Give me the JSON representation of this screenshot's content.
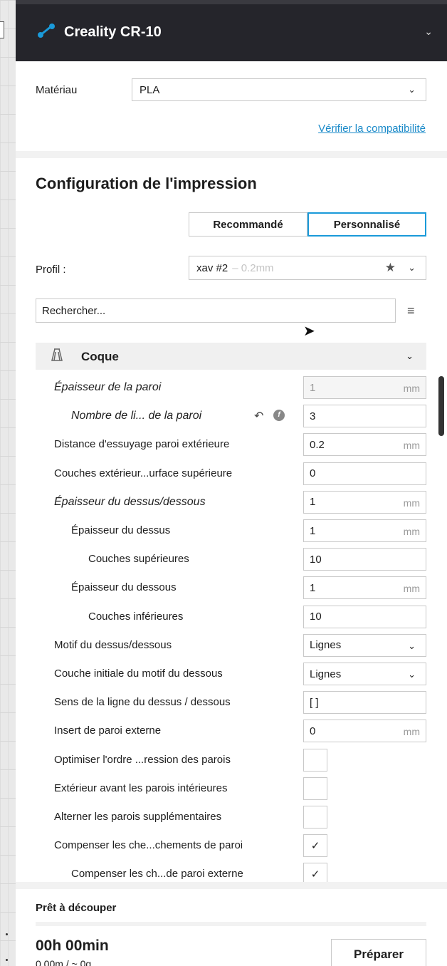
{
  "printer": {
    "name": "Creality CR-10"
  },
  "material": {
    "label": "Matériau",
    "value": "PLA",
    "compat_link": "Vérifier la compatibilité"
  },
  "print_setup": {
    "title": "Configuration de l'impression",
    "modes": [
      "Recommandé",
      "Personnalisé"
    ],
    "active_mode": "Personnalisé",
    "profile_label": "Profil :",
    "profile_name": "xav #2",
    "profile_detail": "– 0.2mm",
    "search_placeholder": "Rechercher...",
    "category": "Coque"
  },
  "settings": [
    {
      "label": "Épaisseur de la paroi",
      "value": "1",
      "unit": "mm",
      "kind": "text",
      "italic": true,
      "indent": 0,
      "disabled": true
    },
    {
      "label": "Nombre de li... de la paroi",
      "value": "3",
      "unit": "",
      "kind": "text",
      "italic": true,
      "indent": 1
    },
    {
      "label": "Distance d'essuyage paroi extérieure",
      "value": "0.2",
      "unit": "mm",
      "kind": "text",
      "indent": 0
    },
    {
      "label": "Couches extérieur...urface supérieure",
      "value": "0",
      "unit": "",
      "kind": "text",
      "indent": 0
    },
    {
      "label": "Épaisseur du dessus/dessous",
      "value": "1",
      "unit": "mm",
      "kind": "text",
      "italic": true,
      "indent": 0
    },
    {
      "label": "Épaisseur du dessus",
      "value": "1",
      "unit": "mm",
      "kind": "text",
      "indent": 1
    },
    {
      "label": "Couches supérieures",
      "value": "10",
      "unit": "",
      "kind": "text",
      "indent": 2
    },
    {
      "label": "Épaisseur du dessous",
      "value": "1",
      "unit": "mm",
      "kind": "text",
      "indent": 1
    },
    {
      "label": "Couches inférieures",
      "value": "10",
      "unit": "",
      "kind": "text",
      "indent": 2
    },
    {
      "label": "Motif du dessus/dessous",
      "value": "Lignes",
      "unit": "",
      "kind": "select",
      "indent": 0
    },
    {
      "label": "Couche initiale du motif du dessous",
      "value": "Lignes",
      "unit": "",
      "kind": "select",
      "indent": 0
    },
    {
      "label": "Sens de la ligne du dessus / dessous",
      "value": "[ ]",
      "unit": "",
      "kind": "text",
      "indent": 0
    },
    {
      "label": "Insert de paroi externe",
      "value": "0",
      "unit": "mm",
      "kind": "text",
      "indent": 0
    },
    {
      "label": "Optimiser l'ordre ...ression des parois",
      "checked": false,
      "kind": "check",
      "indent": 0
    },
    {
      "label": "Extérieur avant les parois intérieures",
      "checked": false,
      "kind": "check",
      "indent": 0
    },
    {
      "label": "Alterner les parois supplémentaires",
      "checked": false,
      "kind": "check",
      "indent": 0
    },
    {
      "label": "Compenser les che...chements de paroi",
      "checked": true,
      "kind": "check",
      "indent": 0
    },
    {
      "label": "Compenser les ch...de paroi externe",
      "checked": true,
      "kind": "check",
      "indent": 1
    }
  ],
  "footer": {
    "status": "Prêt à découper",
    "time": "00h 00min",
    "material_usage": "0.00m / ~ 0g",
    "prepare_label": "Préparer"
  },
  "colors": {
    "header_bg": "#25252b",
    "accent": "#1a9ad9",
    "link": "#1a8ac9"
  },
  "icons": [
    "printer-logo-icon",
    "chevron-down-icon",
    "star-icon",
    "menu-icon",
    "shell-icon",
    "reset-icon",
    "function-icon",
    "checkmark-icon",
    "cursor-icon"
  ]
}
